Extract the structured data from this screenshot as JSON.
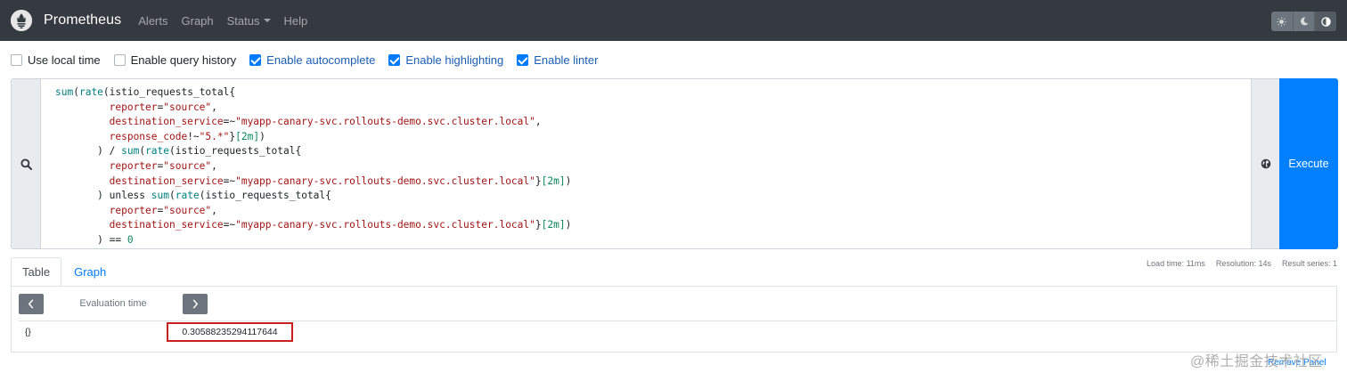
{
  "navbar": {
    "brand": "Prometheus",
    "links": [
      {
        "label": "Alerts"
      },
      {
        "label": "Graph"
      },
      {
        "label": "Status",
        "has_dropdown": true
      },
      {
        "label": "Help"
      }
    ],
    "theme_icons": [
      "sun-icon",
      "moon-icon",
      "contrast-icon"
    ]
  },
  "options": {
    "use_local_time": {
      "label": "Use local time",
      "checked": false
    },
    "enable_query_history": {
      "label": "Enable query history",
      "checked": false
    },
    "enable_autocomplete": {
      "label": "Enable autocomplete",
      "checked": true
    },
    "enable_highlighting": {
      "label": "Enable highlighting",
      "checked": true
    },
    "enable_linter": {
      "label": "Enable linter",
      "checked": true
    }
  },
  "expression": {
    "lines": [
      "sum(rate(istio_requests_total{",
      "         reporter=\"source\",",
      "         destination_service=~\"myapp-canary-svc.rollouts-demo.svc.cluster.local\",",
      "         response_code!~\"5.*\"}[2m])",
      "       ) / sum(rate(istio_requests_total{",
      "         reporter=\"source\",",
      "         destination_service=~\"myapp-canary-svc.rollouts-demo.svc.cluster.local\"}[2m])",
      "       ) unless sum(rate(istio_requests_total{",
      "         reporter=\"source\",",
      "         destination_service=~\"myapp-canary-svc.rollouts-demo.svc.cluster.local\"}[2m])",
      "       ) == 0"
    ],
    "execute_label": "Execute"
  },
  "tabs": [
    {
      "label": "Table",
      "active": true
    },
    {
      "label": "Graph",
      "active": false
    }
  ],
  "stats": {
    "load_time": "Load time: 11ms",
    "resolution": "Resolution: 14s",
    "result_series": "Result series: 1"
  },
  "table": {
    "evaluation_time_placeholder": "Evaluation time",
    "rows": [
      {
        "metric": "{}",
        "value": "0.30588235294117644"
      }
    ]
  },
  "remove_panel": "Remove Panel",
  "watermark": "@稀土掘金技术社区",
  "colors": {
    "navbar_bg": "#343a40",
    "accent": "#007bff",
    "execute_bg": "#0080ff",
    "highlight_border": "#c8201e"
  }
}
